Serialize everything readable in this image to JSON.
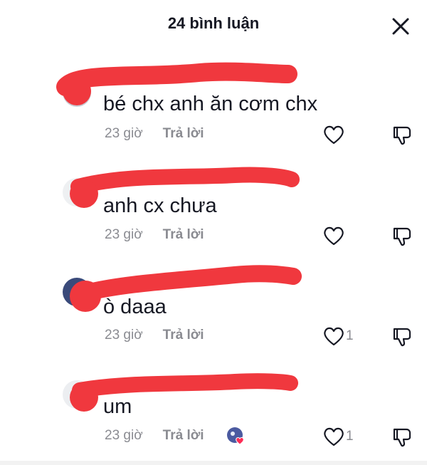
{
  "header": {
    "title": "24 bình luận",
    "close_icon": "close-icon"
  },
  "comments": [
    {
      "text": "bé chx anh ăn cơm chx",
      "time": "23 giờ",
      "reply_label": "Trả lời",
      "like_count": ""
    },
    {
      "text": "anh cx chưa",
      "time": "23 giờ",
      "reply_label": "Trả lời",
      "like_count": ""
    },
    {
      "text": "ò daaa",
      "time": "23 giờ",
      "reply_label": "Trả lời",
      "like_count": "1"
    },
    {
      "text": "um",
      "time": "23 giờ",
      "reply_label": "Trả lời",
      "like_count": "1",
      "author_liked": true
    }
  ],
  "colors": {
    "redaction": "#f0383e",
    "muted_text": "#8a8b91",
    "primary_text": "#161823",
    "heart_badge": "#fe2c55"
  }
}
